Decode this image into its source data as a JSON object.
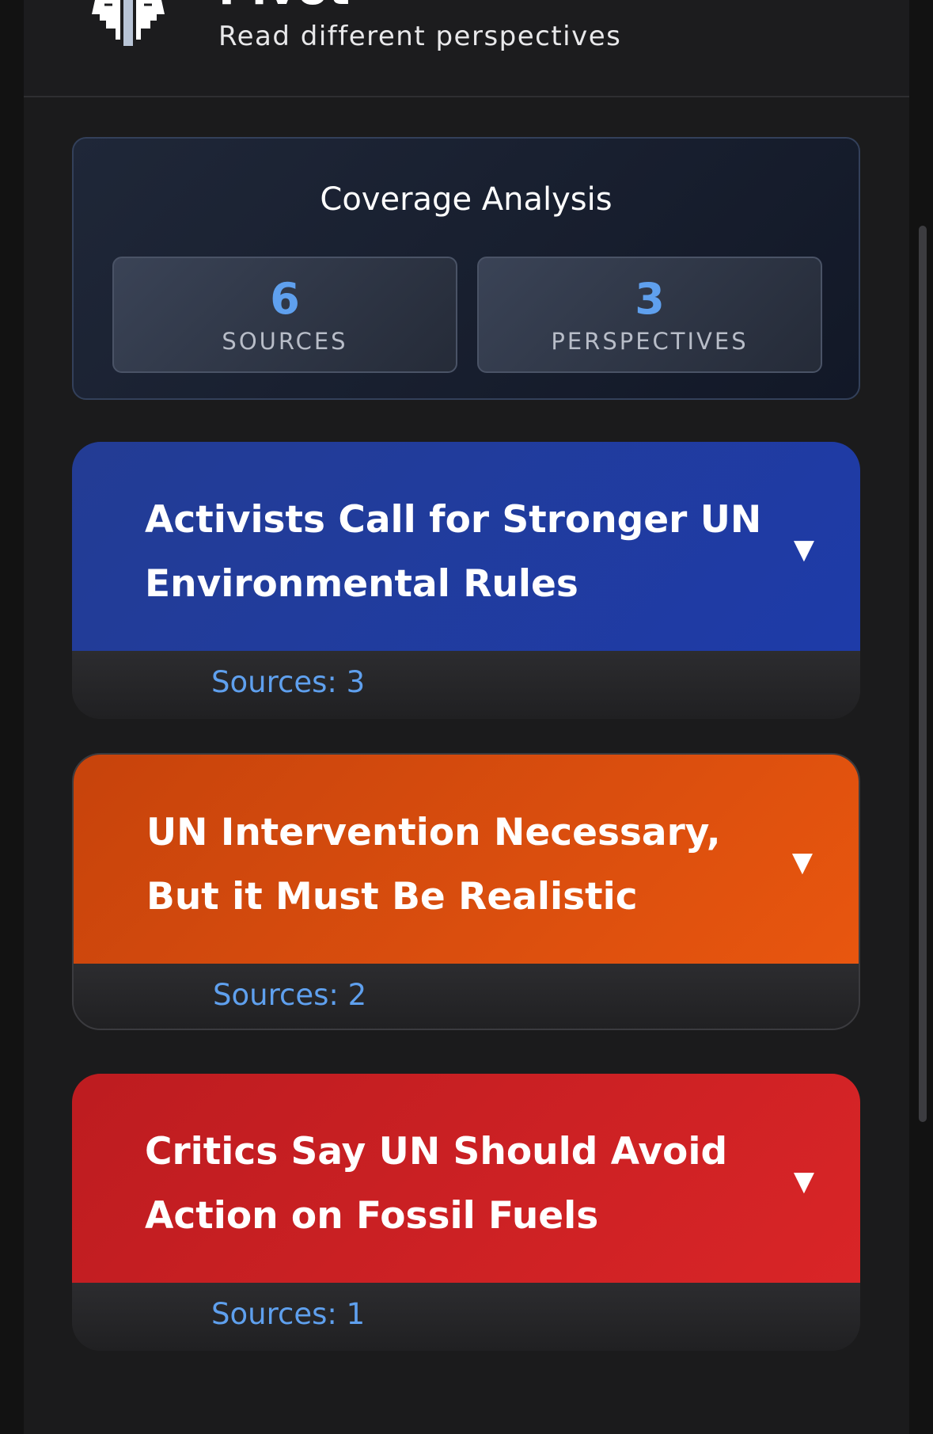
{
  "header": {
    "title": "Pivot",
    "subtitle": "Read different perspectives",
    "logo_icon": "two-heads-icon"
  },
  "coverage": {
    "title": "Coverage Analysis",
    "stats": [
      {
        "value": "6",
        "label": "SOURCES"
      },
      {
        "value": "3",
        "label": "PERSPECTIVES"
      }
    ]
  },
  "perspectives": [
    {
      "title": "Activists Call for Stronger UN Environmental Rules",
      "sources": "Sources: 3",
      "color": "#1e3ba8",
      "expand_icon": "▼"
    },
    {
      "title": "UN Intervention Necessary, But it Must Be Realistic",
      "sources": "Sources: 2",
      "color": "#e8560f",
      "expand_icon": "▼"
    },
    {
      "title": "Critics Say UN Should Avoid Action on Fossil Fuels",
      "sources": "Sources: 1",
      "color": "#d92527",
      "expand_icon": "▼"
    }
  ],
  "colors": {
    "accent": "#5fa0ee",
    "background": "#1b1b1c"
  }
}
